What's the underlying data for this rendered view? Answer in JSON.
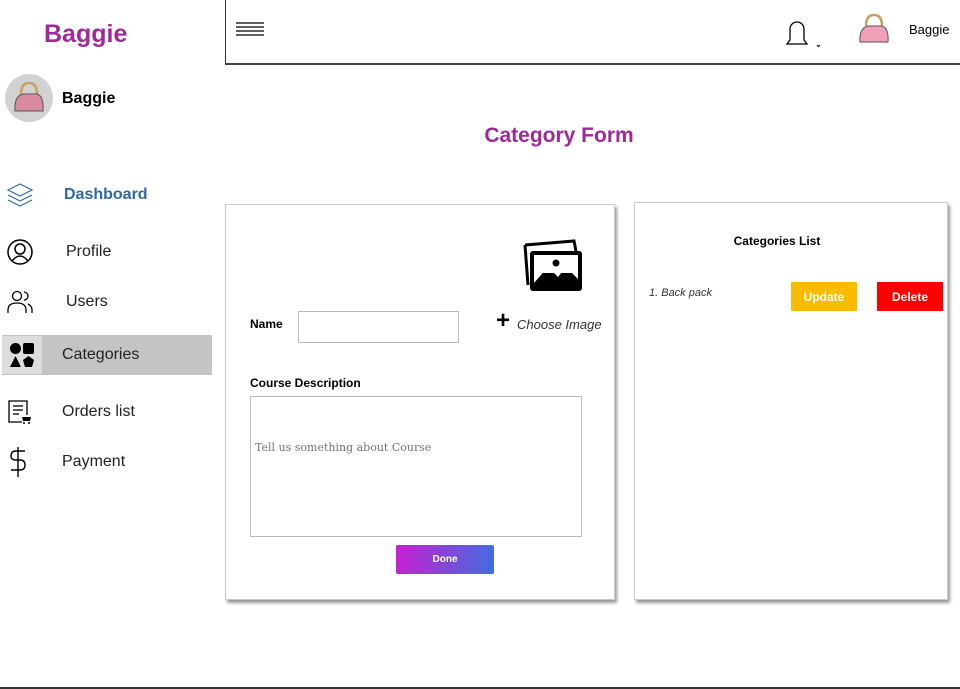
{
  "app": {
    "brand": "Baggie",
    "user_name": "Baggie",
    "topbar_user": "Baggie"
  },
  "sidebar": {
    "items": [
      {
        "label": "Dashboard",
        "icon": "layers-icon"
      },
      {
        "label": "Profile",
        "icon": "user-circle-icon"
      },
      {
        "label": "Users",
        "icon": "users-icon"
      },
      {
        "label": "Categories",
        "icon": "shapes-icon"
      },
      {
        "label": "Orders list",
        "icon": "order-list-icon"
      },
      {
        "label": "Payment",
        "icon": "dollar-icon"
      }
    ]
  },
  "page": {
    "title": "Category Form"
  },
  "form": {
    "name_label": "Name",
    "name_value": "",
    "choose_image": "Choose Image",
    "desc_label": "Course Description",
    "desc_placeholder": "Tell us something about Course",
    "done": "Done"
  },
  "list": {
    "title": "Categories List",
    "items": [
      {
        "label": "1. Back pack",
        "update": "Update",
        "delete": "Delete"
      }
    ]
  },
  "colors": {
    "brand": "#a0299a",
    "dashboard": "#2f6aa8",
    "update": "#f9bc00",
    "delete": "#ff0000"
  }
}
